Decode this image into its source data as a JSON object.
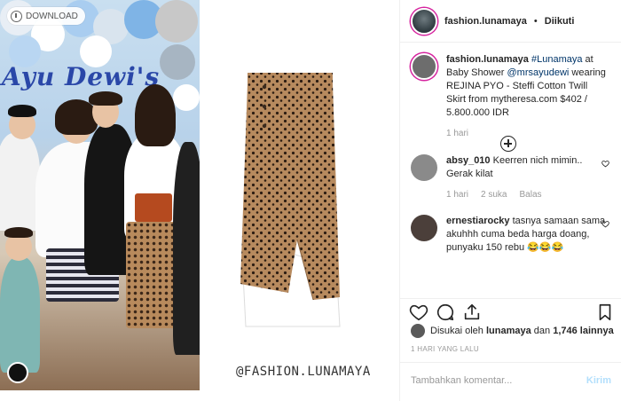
{
  "photo": {
    "download_label": "DOWNLOAD",
    "banner": "Ayu Dewi's",
    "watermark": "@FASHION.LUNAMAYA"
  },
  "header": {
    "username": "fashion.lunamaya",
    "separator": "•",
    "follow_status": "Diikuti"
  },
  "caption": {
    "username": "fashion.lunamaya",
    "hashtag": "#Lunamaya",
    "text_1": " at Baby Shower ",
    "mention": "@mrsayudewi",
    "text_2": " wearing REJINA PYO - Steffi Cotton Twill Skirt from mytheresa.com $402 / 5.800.000 IDR",
    "time": "1 hari"
  },
  "comments": [
    {
      "username": "absy_010",
      "text": "Keerren nich mimin.. Gerak kilat",
      "time": "1 hari",
      "likes": "2 suka",
      "reply": "Balas"
    },
    {
      "username": "ernestiarocky",
      "text": "tasnya samaan sama akuhhh cuma beda harga doang, punyaku 150 rebu 😂😂😂"
    }
  ],
  "likes": {
    "prefix": "Disukai oleh ",
    "user": "lunamaya",
    "mid": " dan ",
    "count": "1,746 lainnya"
  },
  "time_ago": "1 HARI YANG LALU",
  "comment_box": {
    "placeholder": "Tambahkan komentar...",
    "send_label": "Kirim"
  },
  "colors": {
    "link": "#003569",
    "send_disabled": "#b2dffc",
    "story_ring": "#d6249f"
  }
}
